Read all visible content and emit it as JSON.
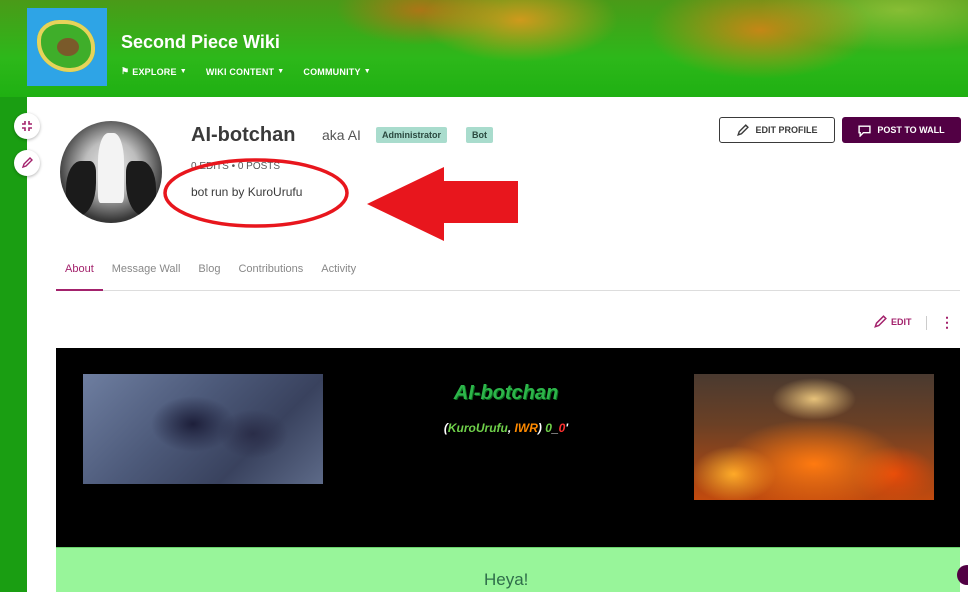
{
  "wiki": {
    "title": "Second Piece Wiki",
    "nav": [
      {
        "label": "EXPLORE",
        "icon": "compass-icon"
      },
      {
        "label": "WIKI CONTENT"
      },
      {
        "label": "COMMUNITY"
      }
    ]
  },
  "profile": {
    "username": "AI-botchan",
    "aka": "aka AI",
    "badges": [
      "Administrator",
      "Bot"
    ],
    "stats": "0 EDITS  •  0 POSTS",
    "bio": "bot run by KuroUrufu"
  },
  "actions": {
    "edit_profile": "EDIT PROFILE",
    "post_to_wall": "POST TO WALL",
    "edit": "EDIT"
  },
  "tabs": [
    {
      "label": "About",
      "active": true
    },
    {
      "label": "Message Wall"
    },
    {
      "label": "Blog"
    },
    {
      "label": "Contributions"
    },
    {
      "label": "Activity"
    }
  ],
  "panel": {
    "title": "AI-botchan",
    "subtitle_parts": [
      "(",
      "KuroUrufu",
      ", ",
      "IWR",
      ") ",
      "0",
      "_",
      "0",
      "'"
    ],
    "greeting": "Heya!"
  },
  "colors": {
    "accent": "#a3226c",
    "post_button": "#520044",
    "badge": "#a9dccd",
    "annotation": "#e8161d",
    "green_box": "#98f59a"
  }
}
